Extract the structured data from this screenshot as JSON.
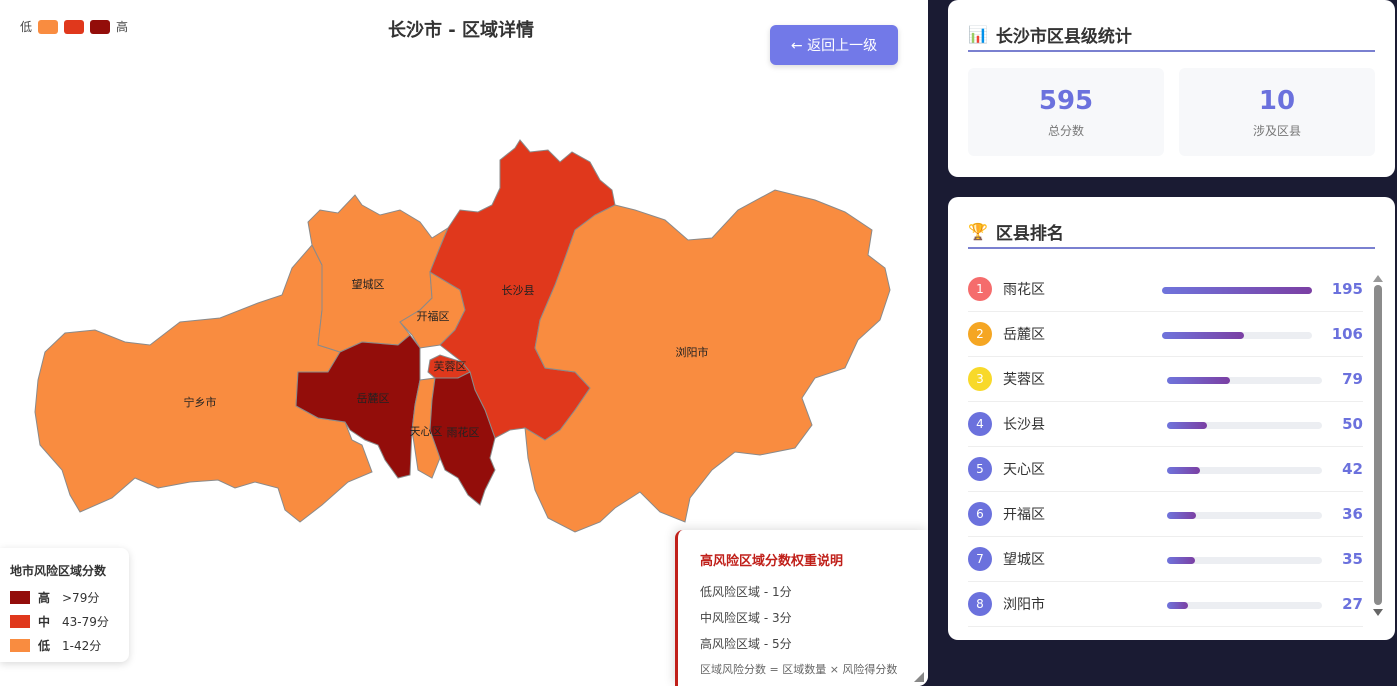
{
  "colors": {
    "low": "#f98c40",
    "mid": "#e0381c",
    "high": "#930d0a",
    "accent": "#6b71dd",
    "border": "#8a8a8a"
  },
  "map": {
    "legend_low": "低",
    "legend_high": "高",
    "title": "长沙市 - 区域详情",
    "back_button": "← 返回上一级",
    "districts": [
      {
        "name": "宁乡市",
        "level": "low"
      },
      {
        "name": "望城区",
        "level": "low"
      },
      {
        "name": "开福区",
        "level": "low"
      },
      {
        "name": "长沙县",
        "level": "mid"
      },
      {
        "name": "浏阳市",
        "level": "low"
      },
      {
        "name": "芙蓉区",
        "level": "mid"
      },
      {
        "name": "岳麓区",
        "level": "high"
      },
      {
        "name": "天心区",
        "level": "low"
      },
      {
        "name": "雨花区",
        "level": "high"
      }
    ]
  },
  "legend": {
    "title": "地市风险区域分数",
    "rows": [
      {
        "level": "高",
        "range": ">79分"
      },
      {
        "level": "中",
        "range": "43-79分"
      },
      {
        "level": "低",
        "range": "1-42分"
      }
    ]
  },
  "note": {
    "title": "高风险区域分数权重说明",
    "lines": [
      "低风险区域 - 1分",
      "中风险区域 - 3分",
      "高风险区域 - 5分"
    ],
    "formula": "区域风险分数 = 区域数量 × 风险得分数"
  },
  "stats": {
    "title": "长沙市区县级统计",
    "icon": "bar-chart-icon",
    "total_value": "595",
    "total_label": "总分数",
    "count_value": "10",
    "count_label": "涉及区县"
  },
  "ranking": {
    "title": "区县排名",
    "icon": "trophy-icon",
    "items": [
      {
        "rank": "1",
        "name": "雨花区",
        "score": "195",
        "fraction": 1.0,
        "badge": "#f56c6c"
      },
      {
        "rank": "2",
        "name": "岳麓区",
        "score": "106",
        "fraction": 0.544,
        "badge": "#f5a623"
      },
      {
        "rank": "3",
        "name": "芙蓉区",
        "score": "79",
        "fraction": 0.405,
        "badge": "#f8d92a"
      },
      {
        "rank": "4",
        "name": "长沙县",
        "score": "50",
        "fraction": 0.256,
        "badge": "#6b71dd"
      },
      {
        "rank": "5",
        "name": "天心区",
        "score": "42",
        "fraction": 0.215,
        "badge": "#6b71dd"
      },
      {
        "rank": "6",
        "name": "开福区",
        "score": "36",
        "fraction": 0.185,
        "badge": "#6b71dd"
      },
      {
        "rank": "7",
        "name": "望城区",
        "score": "35",
        "fraction": 0.179,
        "badge": "#6b71dd"
      },
      {
        "rank": "8",
        "name": "浏阳市",
        "score": "27",
        "fraction": 0.138,
        "badge": "#6b71dd"
      }
    ]
  }
}
